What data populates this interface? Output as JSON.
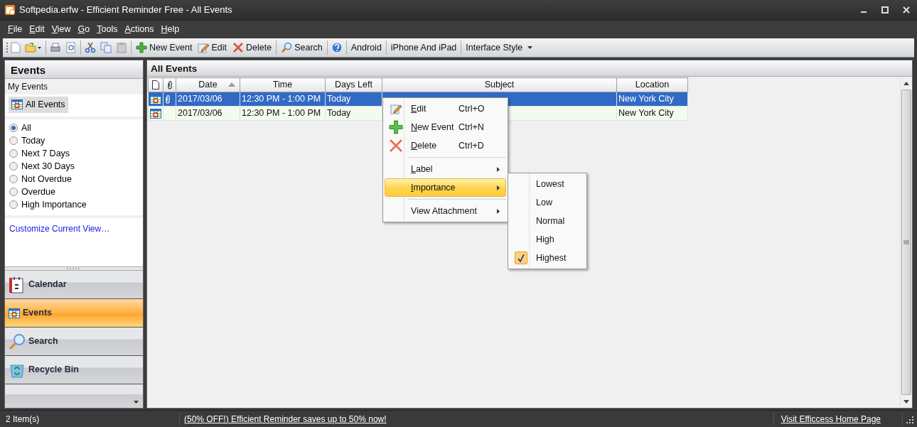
{
  "window": {
    "title": "Softpedia.erfw - Efficient Reminder Free - All Events"
  },
  "menu_bar": [
    "File",
    "Edit",
    "View",
    "Go",
    "Tools",
    "Actions",
    "Help"
  ],
  "toolbar": [
    {
      "label": "New Event",
      "dropdown": false
    },
    {
      "label": "Edit",
      "dropdown": false
    },
    {
      "label": "Delete",
      "dropdown": false
    },
    {
      "label": "Search",
      "dropdown": false
    },
    {
      "label": "Android",
      "dropdown": false
    },
    {
      "label": "iPhone And iPad",
      "dropdown": false
    },
    {
      "label": "Interface Style",
      "dropdown": true
    }
  ],
  "sidebar": {
    "title": "Events",
    "section": "My Events",
    "view": "All Events",
    "filters": [
      {
        "label": "All",
        "selected": true
      },
      {
        "label": "Today",
        "selected": false
      },
      {
        "label": "Next 7 Days",
        "selected": false
      },
      {
        "label": "Next 30 Days",
        "selected": false
      },
      {
        "label": "Not Overdue",
        "selected": false
      },
      {
        "label": "Overdue",
        "selected": false
      },
      {
        "label": "High Importance",
        "selected": false
      }
    ],
    "link": "Customize Current View…",
    "nav": [
      {
        "label": "Calendar",
        "selected": false
      },
      {
        "label": "Events",
        "selected": true
      },
      {
        "label": "Search",
        "selected": false
      },
      {
        "label": "Recycle Bin",
        "selected": false
      }
    ]
  },
  "table": {
    "title": "All Events",
    "columns": [
      {
        "label": "Date",
        "sorted": true
      },
      {
        "label": "Time",
        "sorted": false
      },
      {
        "label": "Days Left",
        "sorted": false
      },
      {
        "label": "Subject",
        "sorted": false
      },
      {
        "label": "Location",
        "sorted": false
      }
    ],
    "rows": [
      {
        "selected": true,
        "attachment": true,
        "date": "2017/03/06",
        "time": "12:30 PM - 1:00 PM",
        "days_left": "Today",
        "location": "New York City"
      },
      {
        "selected": false,
        "attachment": false,
        "date": "2017/03/06",
        "time": "12:30 PM - 1:00 PM",
        "days_left": "Today",
        "location": "New York City"
      }
    ]
  },
  "context_menu": [
    {
      "kind": "command",
      "label": "Edit",
      "shortcut": "Ctrl+O",
      "selected": false
    },
    {
      "kind": "command",
      "label": "New Event",
      "shortcut": "Ctrl+N",
      "selected": false
    },
    {
      "kind": "command",
      "label": "Delete",
      "shortcut": "Ctrl+D",
      "selected": false
    },
    {
      "kind": "separator"
    },
    {
      "kind": "submenu",
      "label": "Label",
      "selected": false
    },
    {
      "kind": "submenu",
      "label": "Importance",
      "selected": true
    },
    {
      "kind": "separator"
    },
    {
      "kind": "submenu",
      "label": "View Attachment",
      "selected": false
    }
  ],
  "submenu": [
    {
      "label": "Lowest",
      "checked": false
    },
    {
      "label": "Low",
      "checked": false
    },
    {
      "label": "Normal",
      "checked": false
    },
    {
      "label": "High",
      "checked": false
    },
    {
      "label": "Highest",
      "checked": true
    }
  ],
  "status_bar": {
    "count": "2 Item(s)",
    "promo": "(50% OFF!) Efficient Reminder saves up to 50% now!",
    "home_link": "Visit Efficcess Home Page"
  }
}
